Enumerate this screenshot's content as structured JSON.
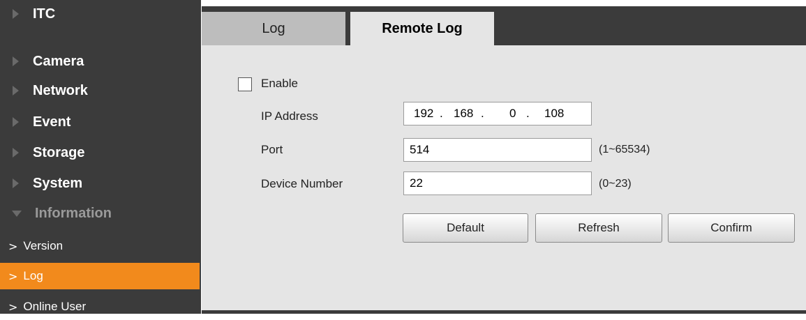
{
  "sidebar": {
    "items": [
      {
        "label": "ITC"
      },
      {
        "label": "Camera"
      },
      {
        "label": "Network"
      },
      {
        "label": "Event"
      },
      {
        "label": "Storage"
      },
      {
        "label": "System"
      },
      {
        "label": "Information"
      }
    ],
    "subitems": [
      {
        "label": "Version"
      },
      {
        "label": "Log"
      },
      {
        "label": "Online User"
      }
    ],
    "active_subitem": "Log"
  },
  "tabs": [
    {
      "label": "Log"
    },
    {
      "label": "Remote Log"
    }
  ],
  "active_tab": "Remote Log",
  "form": {
    "enable_label": "Enable",
    "enable_checked": false,
    "ip_label": "IP Address",
    "ip": [
      "192",
      "168",
      "0",
      "108"
    ],
    "port_label": "Port",
    "port_value": "514",
    "port_hint": "(1~65534)",
    "device_label": "Device Number",
    "device_value": "22",
    "device_hint": "(0~23)"
  },
  "buttons": {
    "default": "Default",
    "refresh": "Refresh",
    "confirm": "Confirm"
  },
  "colors": {
    "sidebar_bg": "#3b3b3b",
    "active_item": "#f28a1c",
    "panel_bg": "#e5e5e5"
  }
}
